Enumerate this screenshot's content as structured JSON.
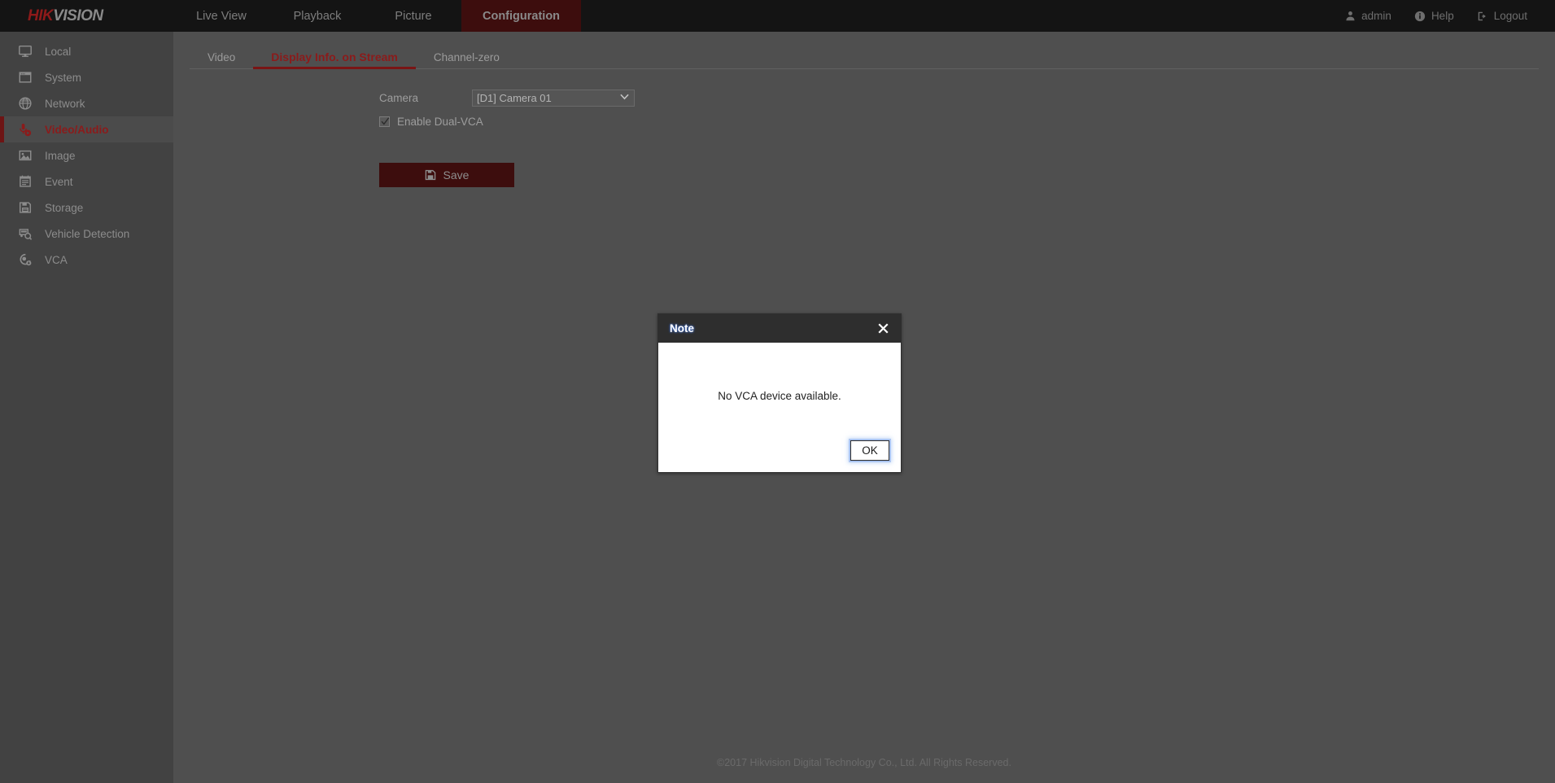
{
  "brand": {
    "part1": "HIK",
    "part2": "VISION"
  },
  "topnav": {
    "tabs": [
      {
        "label": "Live View",
        "active": false
      },
      {
        "label": "Playback",
        "active": false
      },
      {
        "label": "Picture",
        "active": false
      },
      {
        "label": "Configuration",
        "active": true
      }
    ],
    "right": [
      {
        "label": "admin",
        "icon": "user-icon"
      },
      {
        "label": "Help",
        "icon": "info-icon"
      },
      {
        "label": "Logout",
        "icon": "logout-icon"
      }
    ]
  },
  "sidebar": {
    "items": [
      {
        "label": "Local",
        "icon": "monitor-icon",
        "active": false
      },
      {
        "label": "System",
        "icon": "window-icon",
        "active": false
      },
      {
        "label": "Network",
        "icon": "globe-icon",
        "active": false
      },
      {
        "label": "Video/Audio",
        "icon": "microphone-play-icon",
        "active": true
      },
      {
        "label": "Image",
        "icon": "picture-icon",
        "active": false
      },
      {
        "label": "Event",
        "icon": "calendar-icon",
        "active": false
      },
      {
        "label": "Storage",
        "icon": "floppy-disk-icon",
        "active": false
      },
      {
        "label": "Vehicle Detection",
        "icon": "vehicle-search-icon",
        "active": false
      },
      {
        "label": "VCA",
        "icon": "vca-icon",
        "active": false
      }
    ]
  },
  "content": {
    "tabs": [
      {
        "label": "Video",
        "active": false
      },
      {
        "label": "Display Info. on Stream",
        "active": true
      },
      {
        "label": "Channel-zero",
        "active": false
      }
    ],
    "camera_label": "Camera",
    "camera_select": {
      "value": "[D1] Camera 01",
      "options": [
        "[D1] Camera 01"
      ]
    },
    "dual_vca": {
      "label": "Enable Dual-VCA",
      "checked": true
    },
    "save_label": "Save"
  },
  "footer": {
    "text": "©2017 Hikvision Digital Technology Co., Ltd. All Rights Reserved."
  },
  "dialog": {
    "title": "Note",
    "message": "No VCA device available.",
    "ok_label": "OK",
    "close_icon": "close-icon"
  },
  "colors": {
    "accent_red": "#8b1b1b",
    "nav_active_bg": "#3d0d0d",
    "topbar_bg": "#141414",
    "sidebar_bg": "#424242",
    "content_bg": "#4f4f4f",
    "dialog_header_bg": "#2e2e2e"
  }
}
